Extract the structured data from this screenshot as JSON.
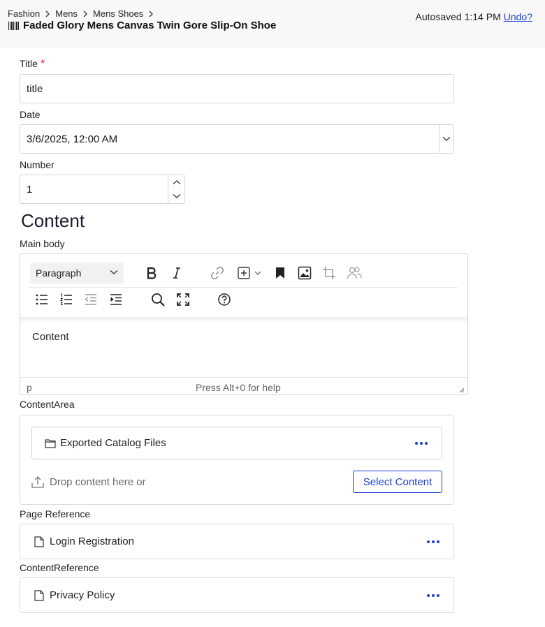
{
  "header": {
    "breadcrumb": [
      "Fashion",
      "Mens",
      "Mens Shoes"
    ],
    "title": "Faded Glory Mens Canvas Twin Gore Slip-On Shoe",
    "autosaved": "Autosaved 1:14 PM",
    "undo": "Undo?"
  },
  "fields": {
    "title_label": "Title",
    "required_mark": "*",
    "title_value": "title",
    "date_label": "Date",
    "date_value": "3/6/2025, 12:00 AM",
    "number_label": "Number",
    "number_value": "1"
  },
  "content": {
    "heading": "Content",
    "main_body_label": "Main body",
    "format_select": "Paragraph",
    "editor_text": "Content",
    "status_path": "p",
    "status_help": "Press Alt+0 for help"
  },
  "content_area": {
    "label": "ContentArea",
    "item": "Exported Catalog Files",
    "drop_text": "Drop content here or",
    "select_button": "Select Content"
  },
  "page_reference": {
    "label": "Page Reference",
    "item": "Login Registration"
  },
  "content_reference": {
    "label": "ContentReference",
    "item": "Privacy Policy"
  },
  "colors": {
    "accent": "#1b3fd6",
    "required": "#e0242c",
    "header_bg": "#f8f8f8"
  }
}
